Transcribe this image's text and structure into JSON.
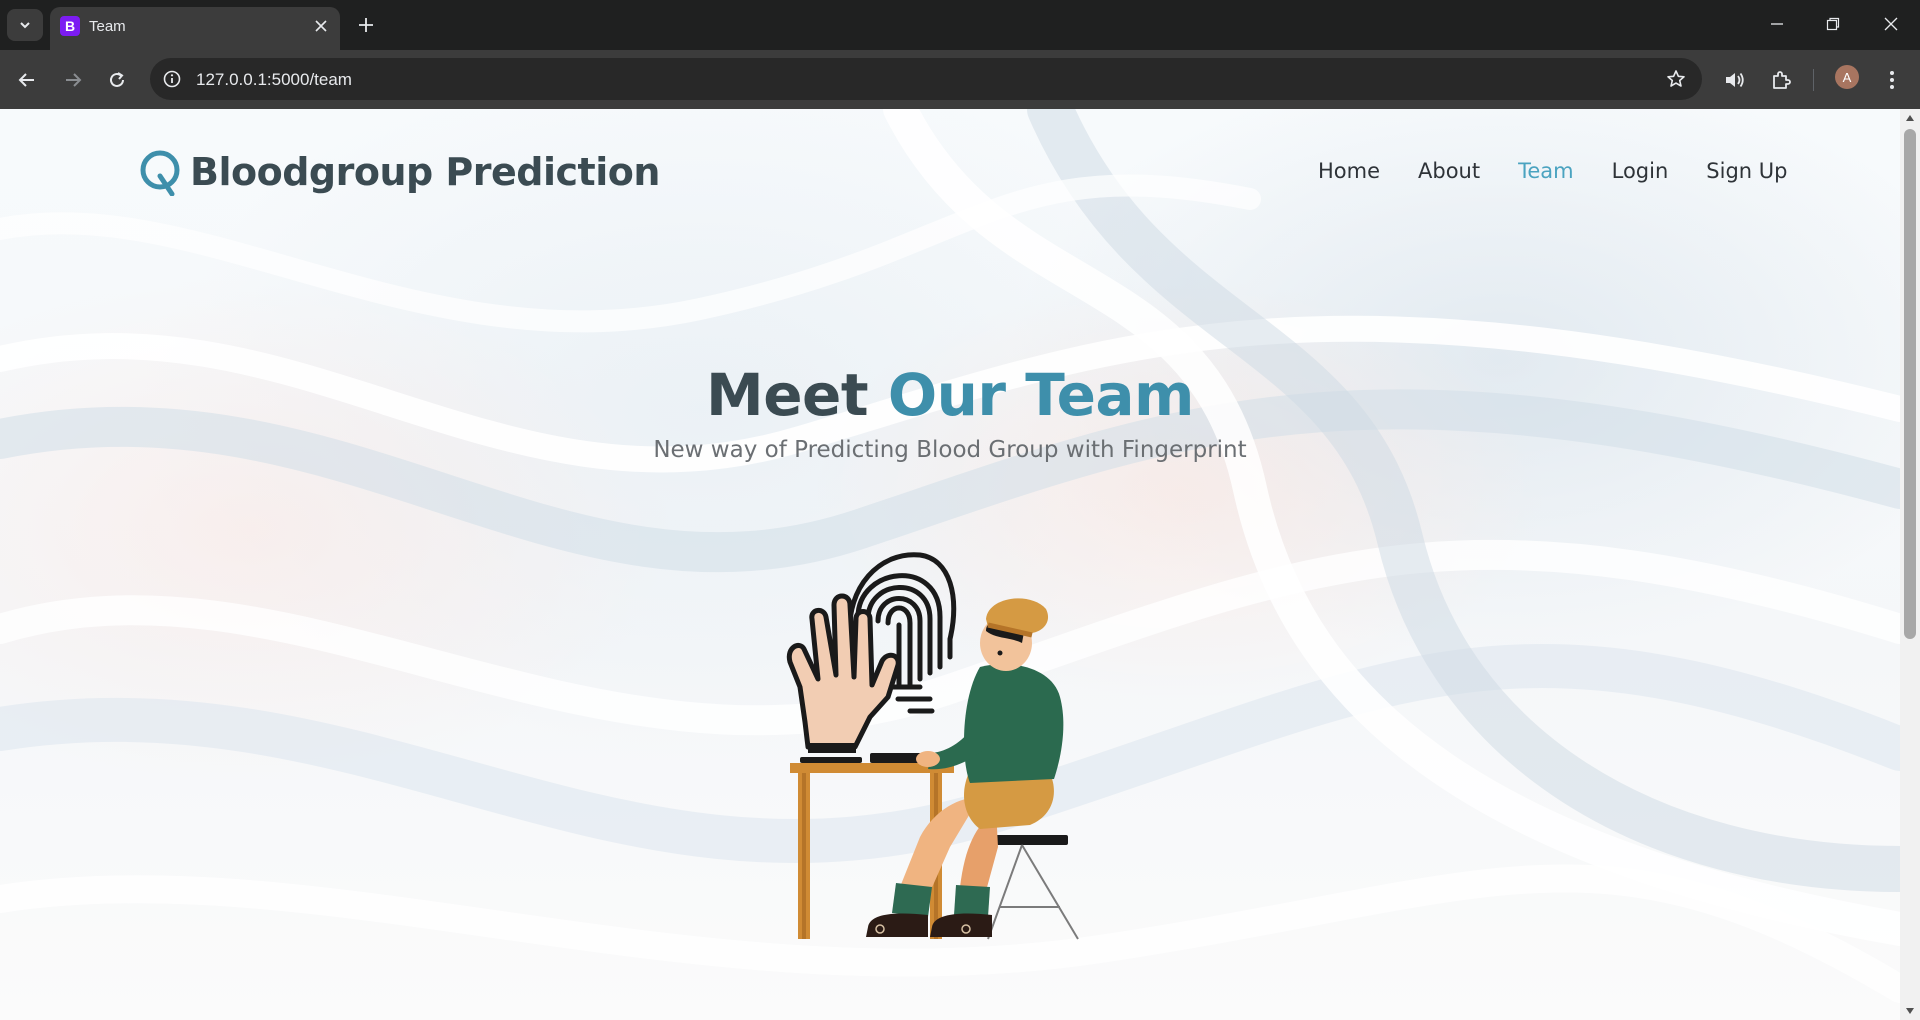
{
  "browser": {
    "tab_title": "Team",
    "tab_favicon_letter": "B",
    "url": "127.0.0.1:5000/team",
    "profile_initial": "A"
  },
  "site": {
    "brand": "Bloodgroup Prediction",
    "nav": [
      {
        "label": "Home"
      },
      {
        "label": "About"
      },
      {
        "label": "Team",
        "active": true
      },
      {
        "label": "Login"
      },
      {
        "label": "Sign Up"
      }
    ]
  },
  "hero": {
    "title_part1": "Meet",
    "title_part2": "Our Team",
    "subtitle": "New way of Predicting Blood Group with Fingerprint"
  },
  "colors": {
    "brand_dark": "#3b4b52",
    "accent": "#3e8fab",
    "nav_active": "#4aa3c0"
  },
  "icons": [
    "tab-search-icon",
    "close-icon",
    "plus-icon",
    "back-icon",
    "forward-icon",
    "reload-icon",
    "info-icon",
    "star-icon",
    "speaker-icon",
    "extensions-icon",
    "kebab-menu-icon",
    "minimize-icon",
    "restore-icon"
  ]
}
